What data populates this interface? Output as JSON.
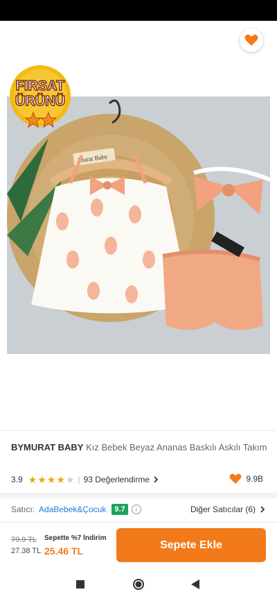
{
  "product": {
    "brand": "BYMURAT BABY",
    "name": "Kız Bebek Beyaz Ananas Baskılı Askılı Takım",
    "image_alt": "Product photo",
    "tag_brand": "Murat Baby"
  },
  "badge": {
    "line1": "FIRSAT",
    "line2": "ÜRÜNÜ"
  },
  "rating": {
    "score": "3.9",
    "stars": 4,
    "reviews_label": "93 Değerlendirme",
    "fav_count": "9.9B"
  },
  "seller": {
    "label": "Satıcı:",
    "name": "AdaBebek&Çocuk",
    "score": "9.7",
    "other_sellers": "Diğer Satıcılar (6)"
  },
  "price": {
    "old": "79.9 TL",
    "current": "27.38 TL",
    "cart_discount": "Sepette %7 İndirim",
    "final": "25.46 TL"
  },
  "actions": {
    "add_to_cart": "Sepete Ekle"
  },
  "colors": {
    "accent": "#f27a1a",
    "seller_link": "#1e7bd7",
    "score_badge": "#1aa35c",
    "star": "#f0a30a"
  },
  "icons": {
    "back": "arrow-left-icon",
    "share": "share-icon",
    "favorite": "heart-icon",
    "nav_recent": "square-icon",
    "nav_home": "circle-icon",
    "nav_back": "triangle-back-icon"
  }
}
